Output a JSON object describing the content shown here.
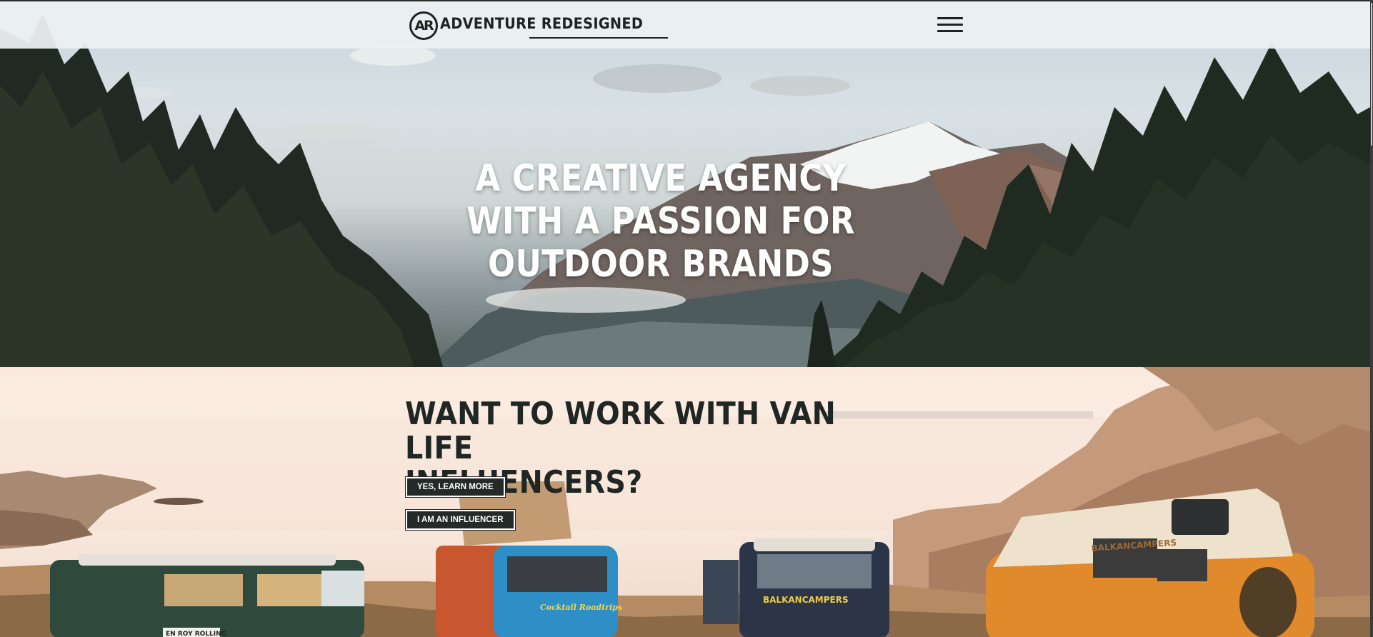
{
  "header": {
    "logo_mark": "AR",
    "logo_text": "ADVENTURE REDESIGNED"
  },
  "hero": {
    "title_lines": [
      "A CREATIVE AGENCY",
      "WITH A PASSION FOR",
      "OUTDOOR BRANDS"
    ]
  },
  "van_section": {
    "title_lines": [
      "WANT TO WORK WITH VAN LIFE",
      "INFLUENCERS?"
    ],
    "primary_button": "YES, LEARN MORE",
    "secondary_button": "I AM AN INFLUENCER",
    "van_labels": [
      "Cocktail Roadtrips",
      "BALKANCAMPERS",
      "BALKANCAMPERS",
      "EN ROY ROLLING"
    ]
  },
  "colors": {
    "header_bg": "#ecf0f2",
    "dark_text": "#1e2321",
    "button_bg": "#232a28",
    "hero_text": "#ffffff"
  }
}
